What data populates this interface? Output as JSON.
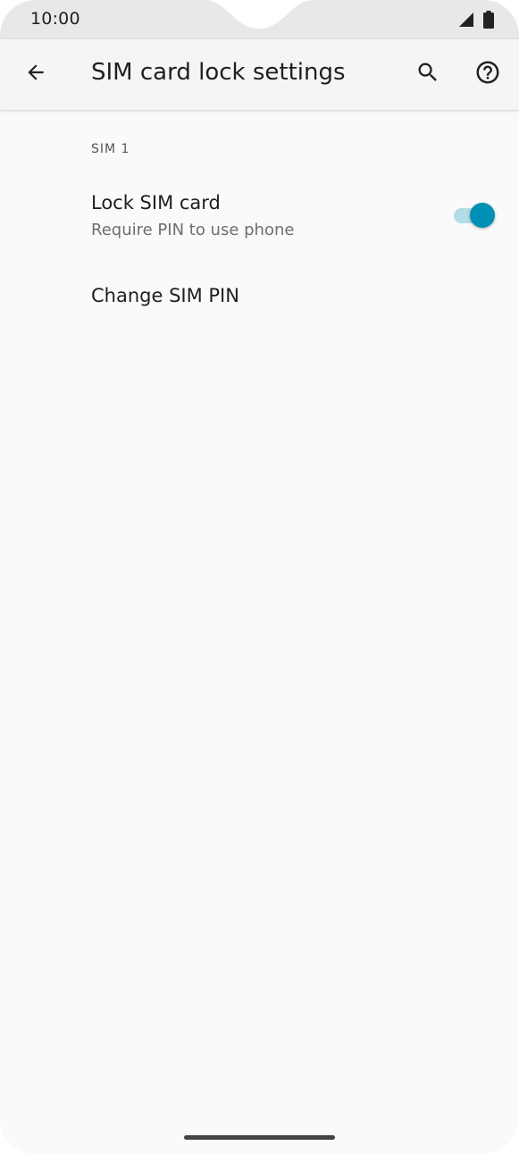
{
  "status_bar": {
    "time": "10:00",
    "icons": [
      "signal-icon",
      "battery-icon"
    ]
  },
  "app_bar": {
    "title": "SIM card lock settings",
    "back_icon": "arrow-back-icon",
    "search_icon": "search-icon",
    "help_icon": "help-icon"
  },
  "content": {
    "section_header": "SIM 1",
    "lock_sim": {
      "title": "Lock SIM card",
      "summary": "Require PIN to use phone",
      "enabled": true
    },
    "change_pin": {
      "title": "Change SIM PIN"
    }
  },
  "colors": {
    "accent": "#0090b5",
    "accent_track": "#b3dde6",
    "background": "#fafafa",
    "app_bar": "#f5f5f5",
    "status_bar": "#e8e8e8"
  }
}
